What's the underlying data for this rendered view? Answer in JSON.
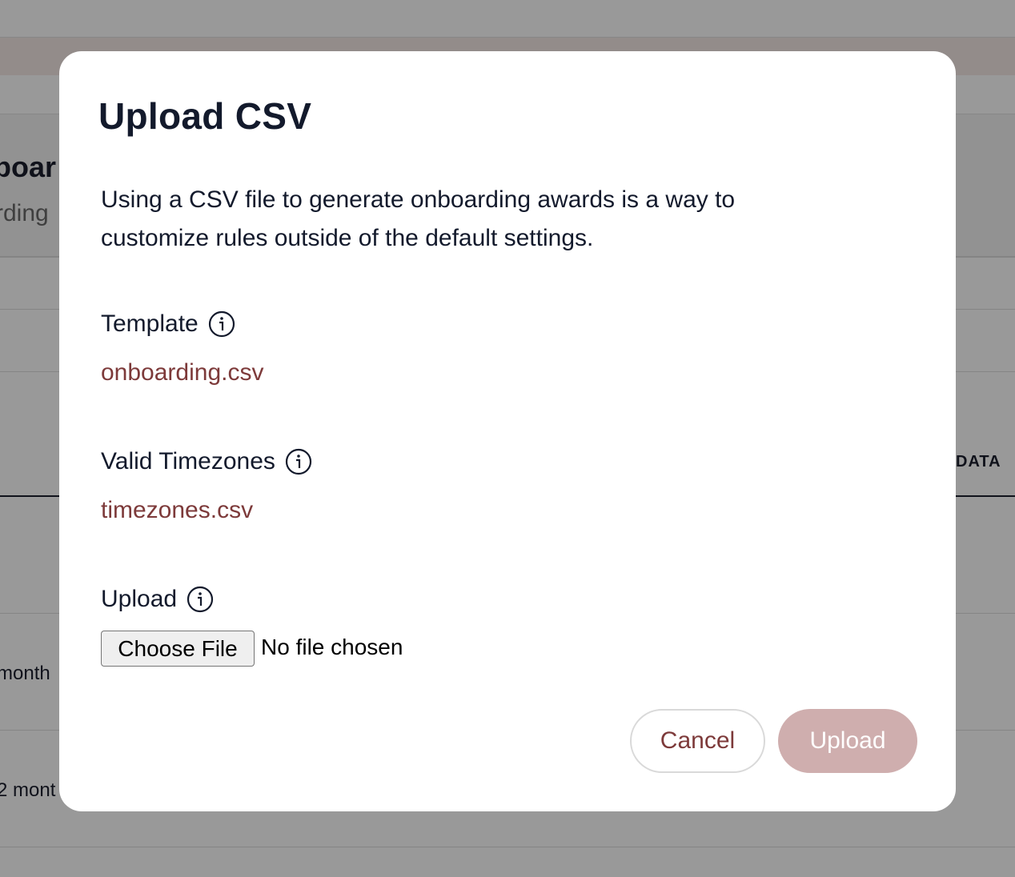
{
  "background": {
    "title_fragment": "boar",
    "subtitle_fragment": "rding",
    "column_header": "DATA",
    "rows": [
      "month",
      "2 mont"
    ]
  },
  "modal": {
    "title": "Upload CSV",
    "description": "Using a CSV file to generate onboarding awards is a way to customize rules outside of the default settings.",
    "template": {
      "label": "Template",
      "file": "onboarding.csv"
    },
    "timezones": {
      "label": "Valid Timezones",
      "file": "timezones.csv"
    },
    "upload": {
      "label": "Upload",
      "choose_label": "Choose File",
      "status": "No file chosen"
    },
    "buttons": {
      "cancel": "Cancel",
      "upload": "Upload"
    }
  },
  "colors": {
    "accent": "#7d3a3a",
    "upload_disabled": "#cfaeae",
    "text": "#131a2c",
    "overlay": "rgba(0,0,0,0.40)"
  },
  "icons": [
    "info-icon"
  ]
}
